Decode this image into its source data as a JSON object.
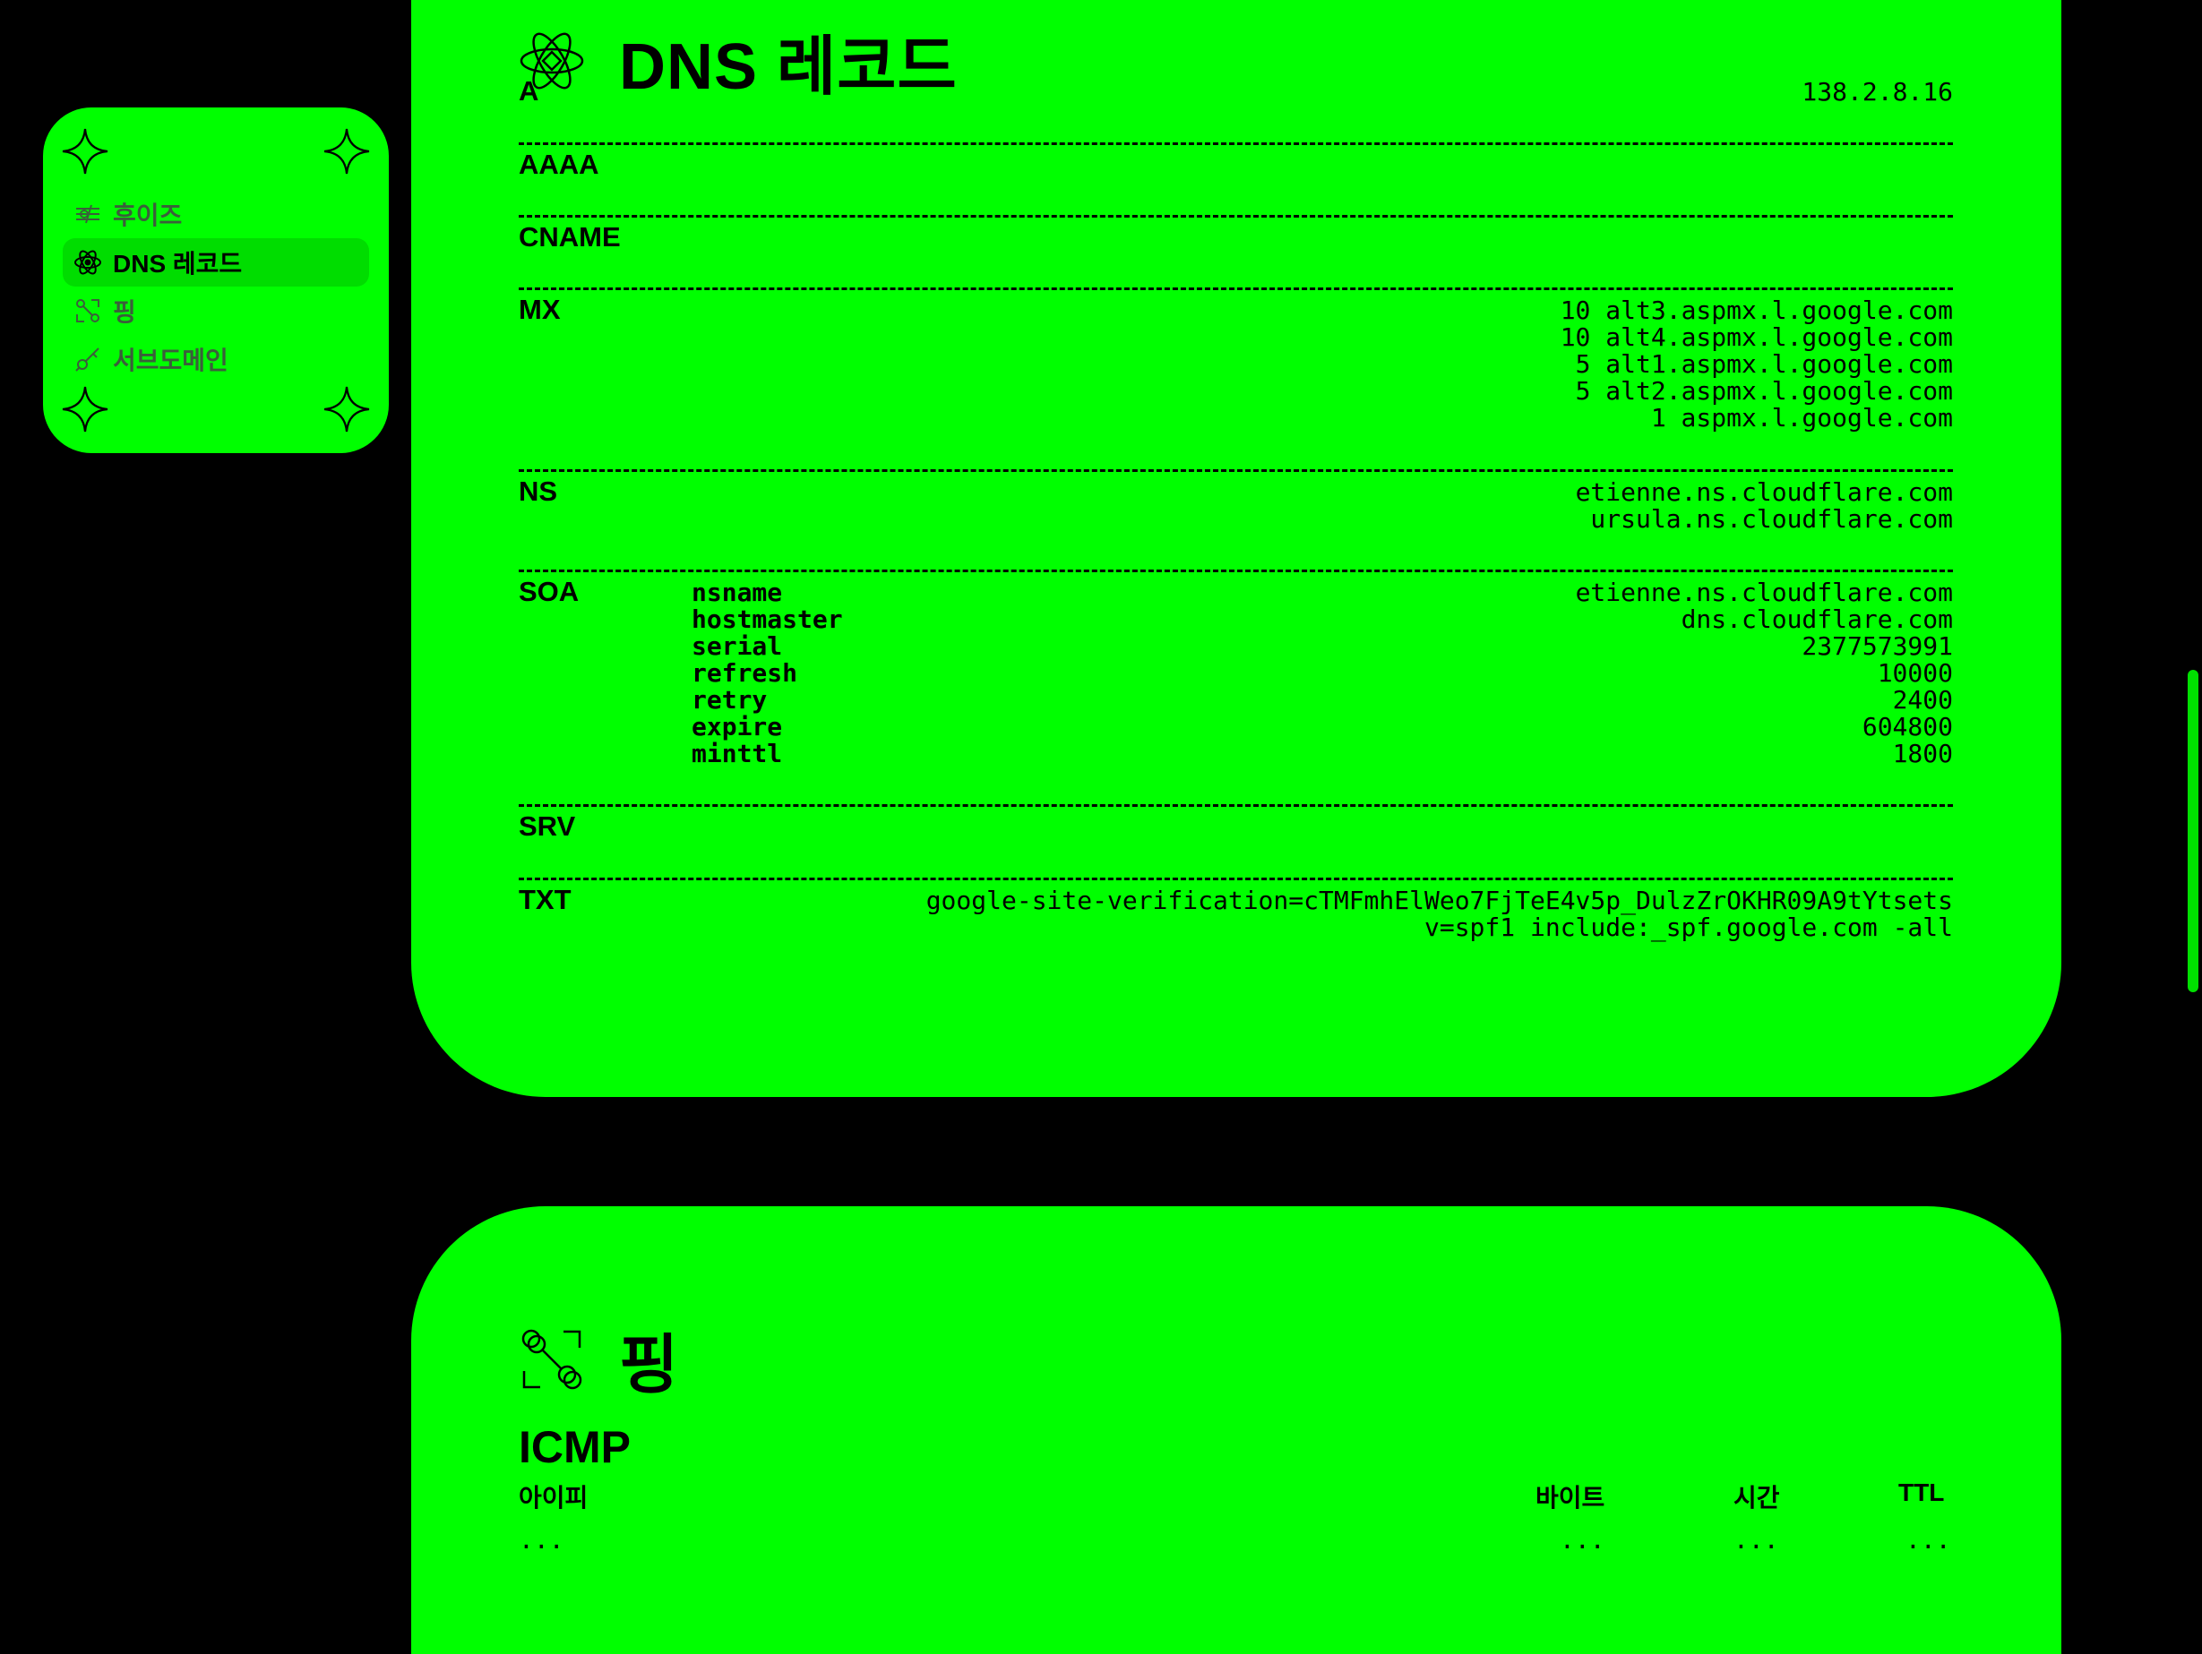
{
  "sidebar": {
    "items": [
      {
        "label": "후이즈",
        "icon": "whois-icon"
      },
      {
        "label": "DNS 레코드",
        "icon": "atom-icon",
        "active": true
      },
      {
        "label": "핑",
        "icon": "ping-icon"
      },
      {
        "label": "서브도메인",
        "icon": "subdomain-icon"
      }
    ]
  },
  "dns": {
    "title": "DNS 레코드",
    "records": {
      "a": {
        "type": "A",
        "values": [
          "138.2.8.16"
        ]
      },
      "aaaa": {
        "type": "AAAA",
        "values": []
      },
      "cname": {
        "type": "CNAME",
        "values": []
      },
      "mx": {
        "type": "MX",
        "values": [
          "10 alt3.aspmx.l.google.com",
          "10 alt4.aspmx.l.google.com",
          "5 alt1.aspmx.l.google.com",
          "5 alt2.aspmx.l.google.com",
          "1 aspmx.l.google.com"
        ]
      },
      "ns": {
        "type": "NS",
        "values": [
          "etienne.ns.cloudflare.com",
          "ursula.ns.cloudflare.com"
        ]
      },
      "soa": {
        "type": "SOA",
        "fields": [
          {
            "key": "nsname",
            "value": "etienne.ns.cloudflare.com"
          },
          {
            "key": "hostmaster",
            "value": "dns.cloudflare.com"
          },
          {
            "key": "serial",
            "value": "2377573991"
          },
          {
            "key": "refresh",
            "value": "10000"
          },
          {
            "key": "retry",
            "value": "2400"
          },
          {
            "key": "expire",
            "value": "604800"
          },
          {
            "key": "minttl",
            "value": "1800"
          }
        ]
      },
      "srv": {
        "type": "SRV",
        "values": []
      },
      "txt": {
        "type": "TXT",
        "values": [
          "google-site-verification=cTMFmhElWeo7FjTeE4v5p_DulzZrOKHR09A9tYtsets",
          "v=spf1 include:_spf.google.com -all"
        ]
      }
    }
  },
  "ping": {
    "title": "핑",
    "section": "ICMP",
    "columns": {
      "ip": "아이피",
      "bytes": "바이트",
      "time": "시간",
      "ttl": "TTL"
    },
    "row": {
      "ip": "...",
      "bytes": "...",
      "time": "...",
      "ttl": "..."
    }
  },
  "colors": {
    "accent": "#00ff00",
    "background": "#000000",
    "active_item": "#00dd00"
  }
}
